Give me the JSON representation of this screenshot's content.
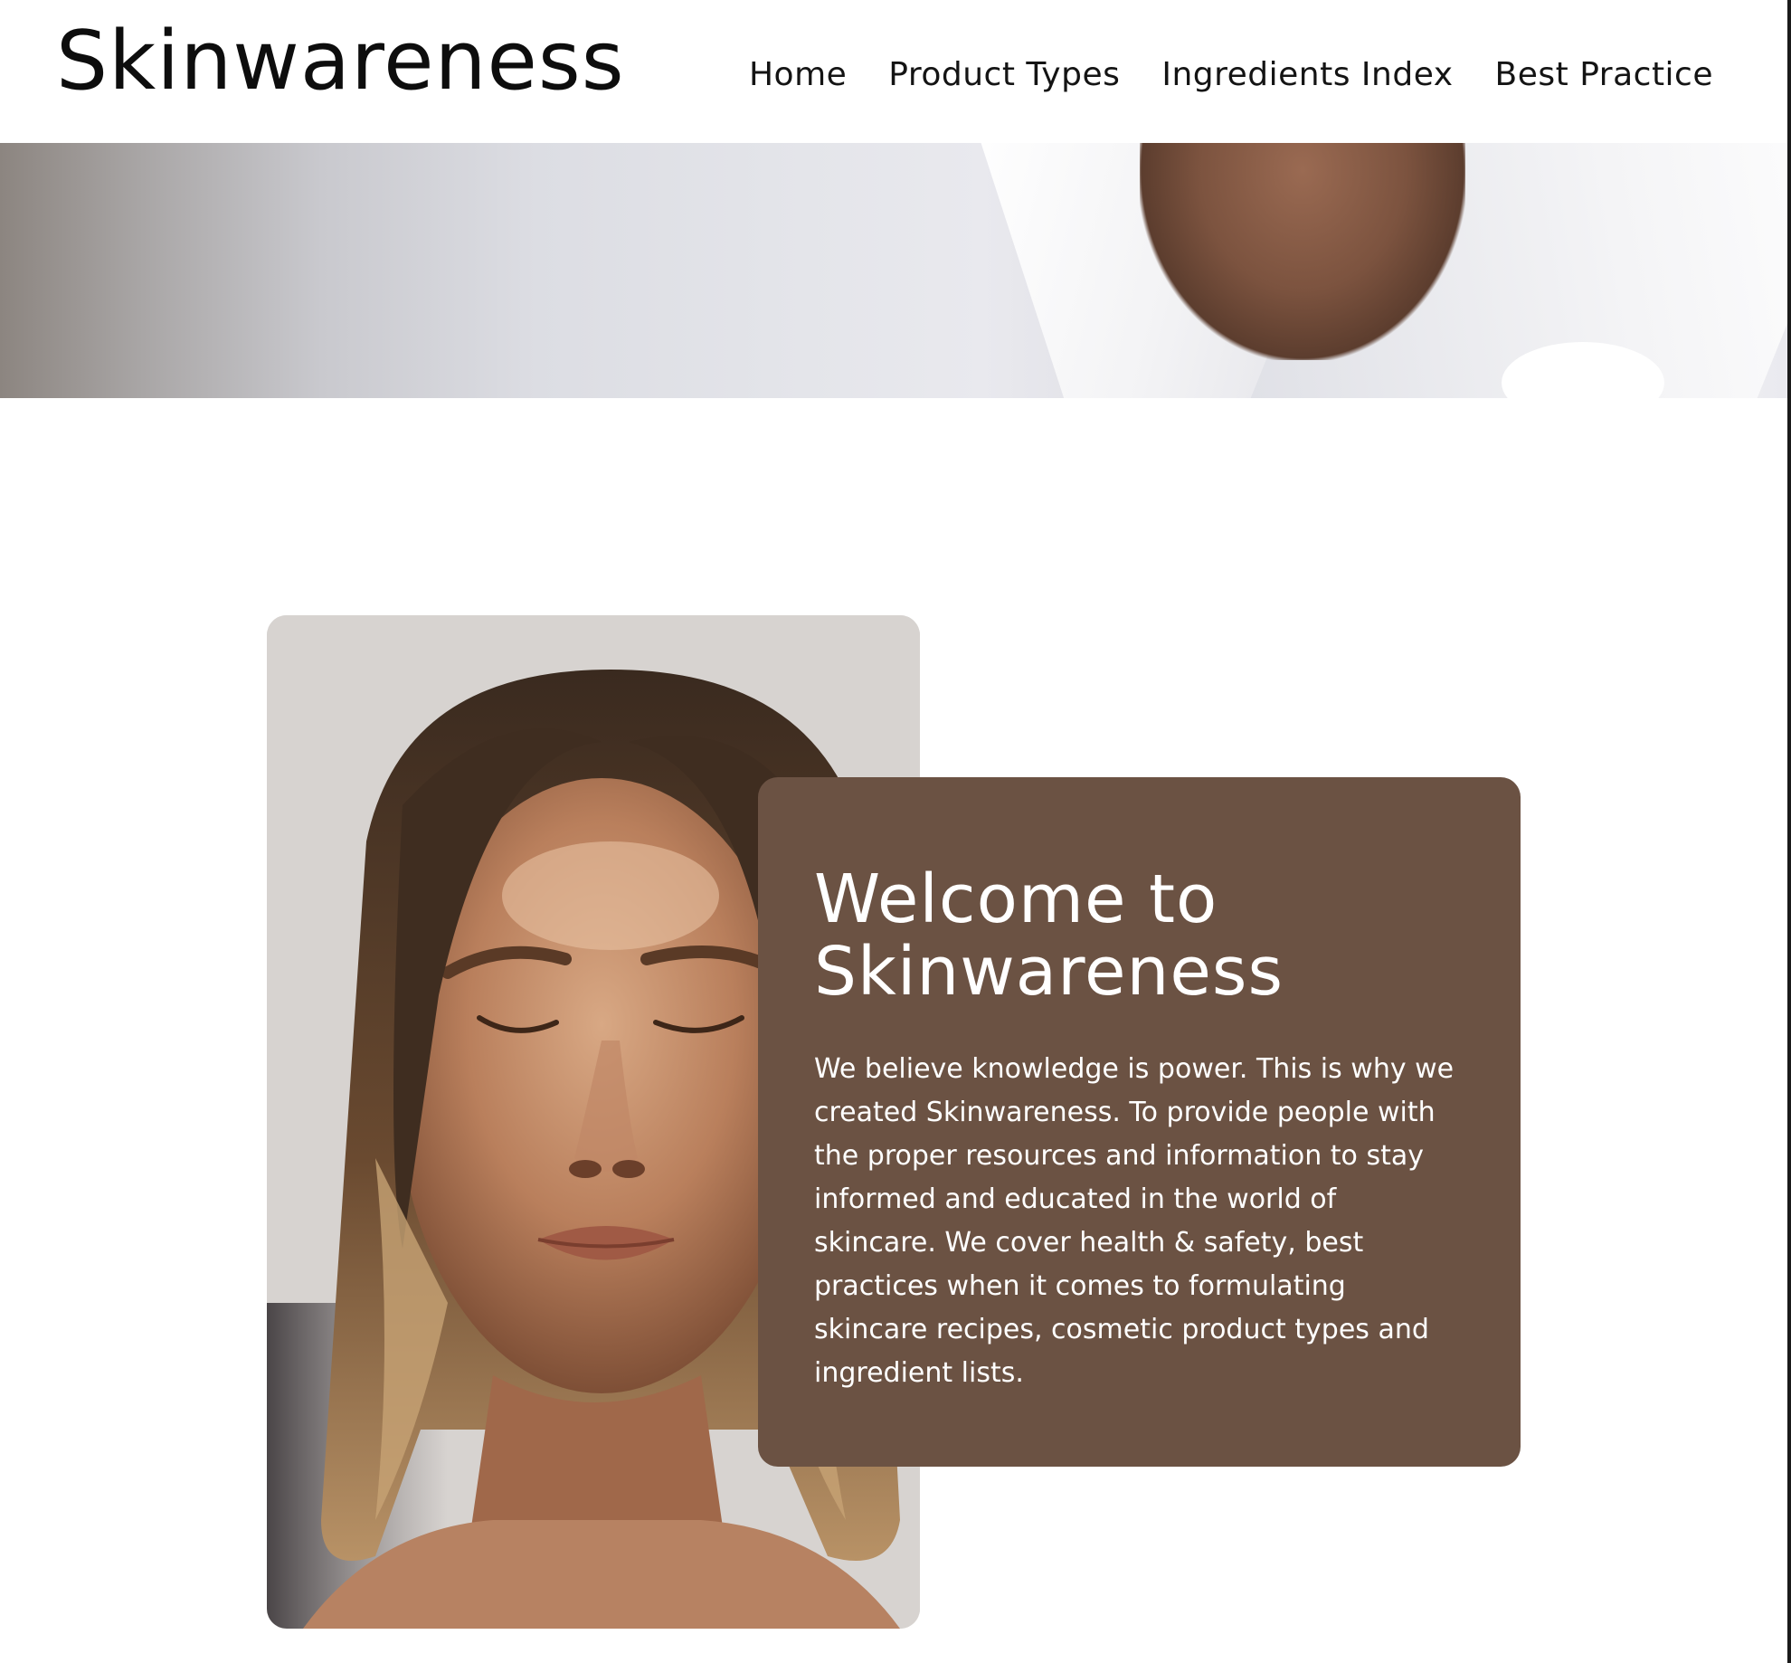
{
  "site": {
    "logo": "Skinwareness"
  },
  "nav": {
    "items": [
      {
        "label": "Home"
      },
      {
        "label": "Product Types"
      },
      {
        "label": "Ingredients Index"
      },
      {
        "label": "Best Practice"
      }
    ]
  },
  "welcome": {
    "title_line1": "Welcome to",
    "title_line2": "Skinwareness",
    "body": "We believe knowledge is power. This is why we created Skinwareness. To provide people with the proper resources and information to stay informed and educated in the world of skincare. We cover health & safety, best practices when it comes to formulating skincare recipes, cosmetic product types and ingredient lists."
  },
  "colors": {
    "card_background": "#6b5243",
    "text_dark": "#111111",
    "page_background": "#ffffff"
  }
}
